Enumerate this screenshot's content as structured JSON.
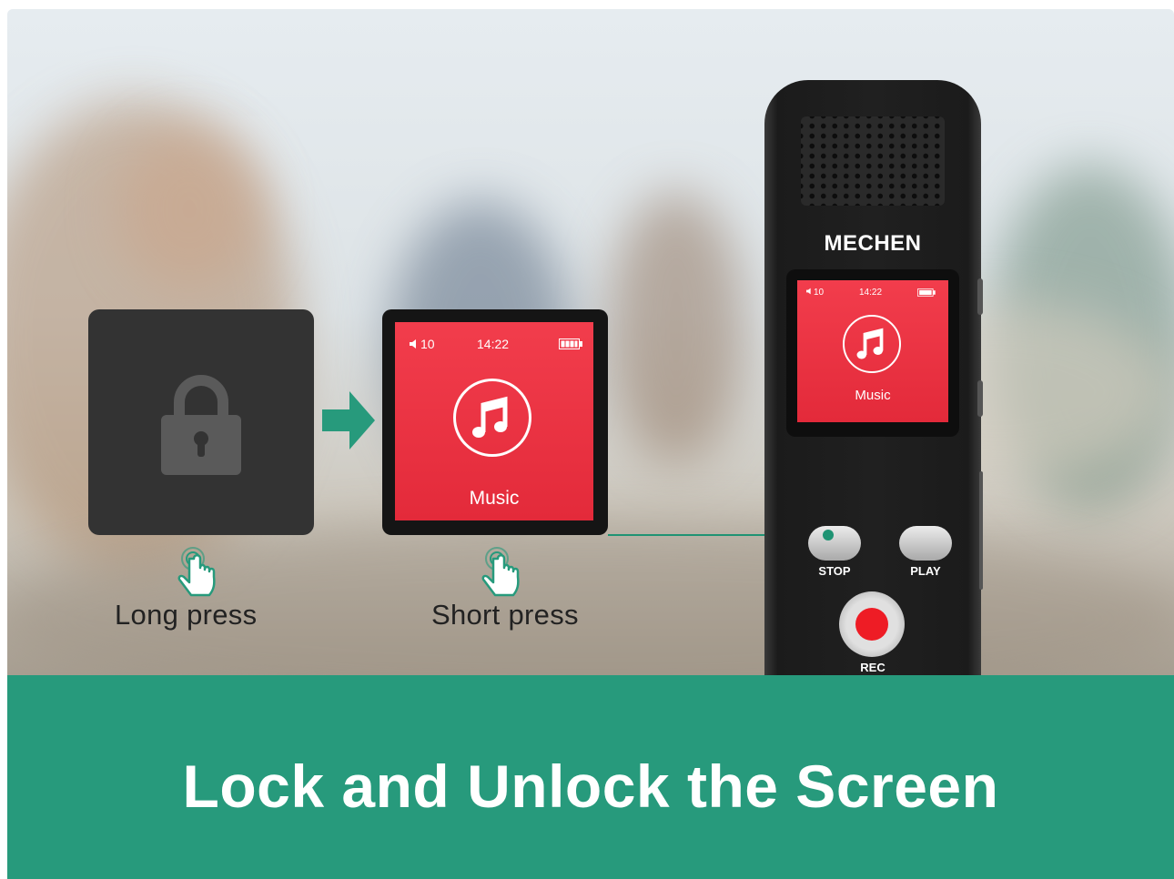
{
  "colors": {
    "accent_green": "#279a7c",
    "screen_red": "#e32a3a",
    "lock_card": "#333333",
    "rec_red": "#ee1c25"
  },
  "lock_card": {
    "icon": "padlock-icon"
  },
  "music_card": {
    "volume": "10",
    "time": "14:22",
    "icon": "music-note-icon",
    "label": "Music"
  },
  "captions": {
    "long_press": "Long press",
    "short_press": "Short press"
  },
  "device": {
    "brand": "MECHEN",
    "screen": {
      "volume": "10",
      "time": "14:22",
      "label": "Music"
    },
    "buttons": {
      "stop": "STOP",
      "play": "PLAY",
      "rec": "REC"
    }
  },
  "banner": {
    "title": "Lock and Unlock the Screen"
  }
}
